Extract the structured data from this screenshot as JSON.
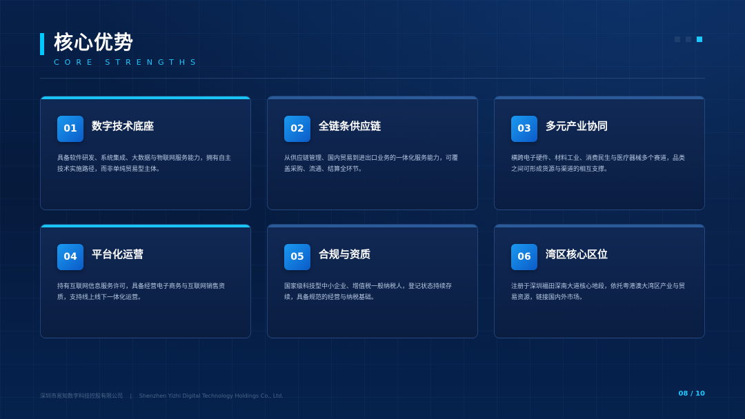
{
  "header": {
    "title": "核心优势",
    "subtitle": "CORE STRENGTHS"
  },
  "cards": [
    {
      "number": "01",
      "title": "数字技术底座",
      "text": "具备软件研发、系统集成、大数据与物联网服务能力，拥有自主技术实施路径，而非单纯贸易型主体。",
      "highlight": true
    },
    {
      "number": "02",
      "title": "全链条供应链",
      "text": "从供应链管理、国内贸易到进出口业务的一体化服务能力，可覆盖采购、流通、结算全环节。",
      "highlight": false
    },
    {
      "number": "03",
      "title": "多元产业协同",
      "text": "横跨电子硬件、材料工业、消费民生与医疗器械多个赛道，品类之间可形成货源与渠道的相互支撑。",
      "highlight": false
    },
    {
      "number": "04",
      "title": "平台化运营",
      "text": "持有互联网信息服务许可，具备经营电子商务与互联网销售资质，支持线上线下一体化运营。",
      "highlight": true
    },
    {
      "number": "05",
      "title": "合规与资质",
      "text": "国家级科技型中小企业、增值税一般纳税人，登记状态持续存续，具备规范的经营与纳税基础。",
      "highlight": false
    },
    {
      "number": "06",
      "title": "湾区核心区位",
      "text": "注册于深圳福田深南大道核心地段，依托粤港澳大湾区产业与贸易资源，链接国内外市场。",
      "highlight": false
    }
  ],
  "footer": {
    "company_cn": "深圳市易知数字科技控股有限公司",
    "separator": "|",
    "company_en": "Shenzhen Yizhi Digital Technology Holdings Co., Ltd.",
    "page": "08 / 10"
  },
  "colors": {
    "accent": "#1ec8ff",
    "background": "#06193a"
  }
}
